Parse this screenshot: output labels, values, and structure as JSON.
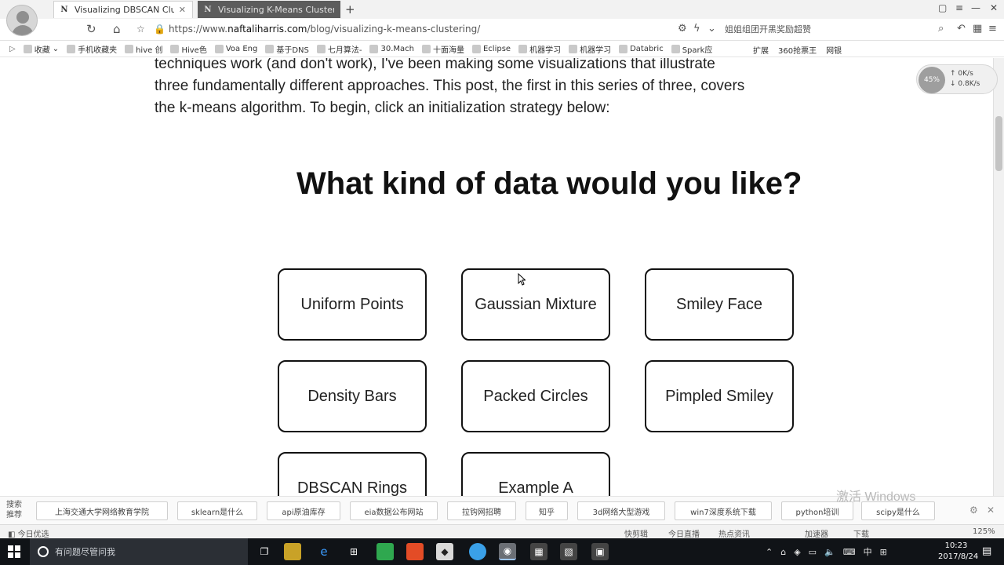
{
  "browser": {
    "tabs": [
      {
        "title": "Visualizing DBSCAN Clusterin",
        "favicon": "N",
        "active": true
      },
      {
        "title": "Visualizing K-Means Clusterin",
        "favicon": "N",
        "active": false
      }
    ],
    "new_tab": "+",
    "url": {
      "scheme": "https://www.",
      "host": "naftaliharris.com",
      "path": "/blog/visualizing-k-means-clustering/"
    },
    "search_hint": "姐姐组团开黑奖励超赞",
    "bookmarks": [
      "收藏",
      "手机收藏夹",
      "hive 创",
      "Hive色",
      "Voa Eng",
      "基于DNS",
      "七月算法-",
      "30.Mach",
      "十面海量",
      "Eclipse",
      "机器学习",
      "机器学习",
      "Databric",
      "Spark应"
    ],
    "bookmarks_right": [
      "扩展",
      "360抢票王",
      "网银"
    ],
    "speed_widget": {
      "percent": "45%",
      "up": "0K/s",
      "down": "0.8K/s"
    }
  },
  "page": {
    "intro_line0": "techniques work (and don't work), I've been making some visualizations that illustrate",
    "intro_line1": "three fundamentally different approaches. This post, the first in this series of three, covers",
    "intro_line2": "the k-means algorithm. To begin, click an initialization strategy below:",
    "heading": "What kind of data would you like?",
    "options": [
      "Uniform Points",
      "Gaussian Mixture",
      "Smiley Face",
      "Density Bars",
      "Packed Circles",
      "Pimpled Smiley",
      "DBSCAN Rings",
      "Example A"
    ]
  },
  "suggestions": {
    "label": "搜索推荐",
    "items": [
      "上海交通大学网络教育学院",
      "sklearn是什么",
      "api原油库存",
      "eia数据公布网站",
      "拉钩网招聘",
      "知乎",
      "3d网络大型游戏",
      "win7深度系统下载",
      "python培训",
      "scipy是什么"
    ]
  },
  "watermark": "激活 Windows",
  "statusbar": {
    "left": "今日优选",
    "items": [
      "快剪辑",
      "今日直播",
      "热点资讯",
      "加速器",
      "下载"
    ],
    "zoom": "125%"
  },
  "taskbar": {
    "search_placeholder": "有问题尽管问我",
    "ime": "中",
    "time": "10:23",
    "date": "2017/8/24"
  }
}
